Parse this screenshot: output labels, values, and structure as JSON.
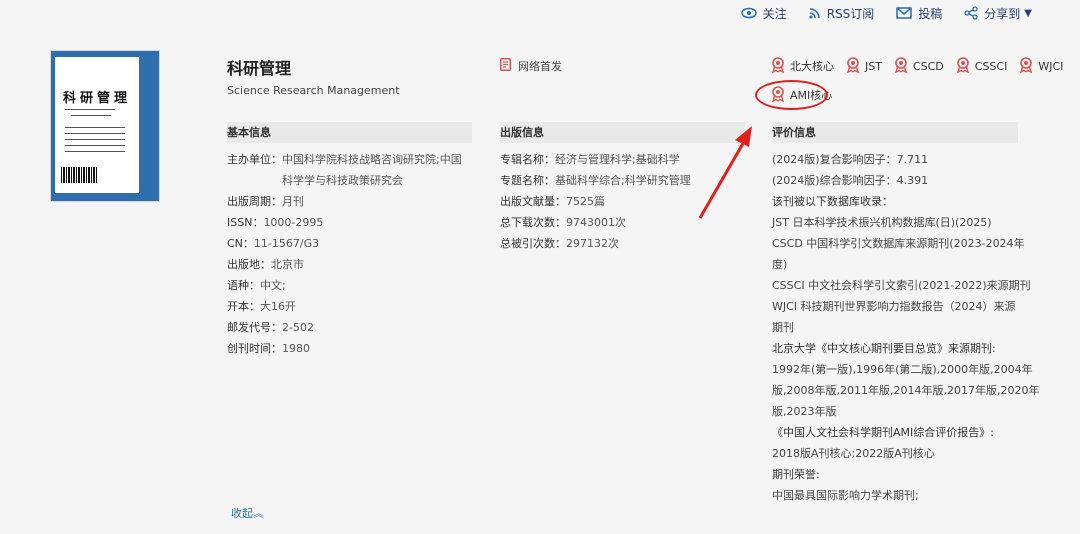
{
  "toolbar": {
    "follow": "关注",
    "rss": "RSS订阅",
    "submit": "投稿",
    "share": "分享到"
  },
  "cover": {
    "title": "科研管理"
  },
  "journal": {
    "title": "科研管理",
    "subtitle": "Science Research Management",
    "net_first": "网络首发"
  },
  "badges": [
    "北大核心",
    "JST",
    "CSCD",
    "CSSCI",
    "WJCI",
    "AMI核心"
  ],
  "basic": {
    "heading": "基本信息",
    "rows": [
      {
        "k": "主办单位：",
        "v": "中国科学院科技战略咨询研究院;中国科学学与科技政策研究会"
      },
      {
        "k": "出版周期：",
        "v": "月刊"
      },
      {
        "k": "ISSN：",
        "v": "1000-2995"
      },
      {
        "k": "CN：",
        "v": "11-1567/G3"
      },
      {
        "k": "出版地：",
        "v": "北京市"
      },
      {
        "k": "语种：",
        "v": "中文;"
      },
      {
        "k": "开本：",
        "v": "大16开"
      },
      {
        "k": "邮发代号：",
        "v": "2-502"
      },
      {
        "k": "创刊时间：",
        "v": "1980"
      }
    ]
  },
  "publish": {
    "heading": "出版信息",
    "rows": [
      {
        "k": "专辑名称：",
        "v": "经济与管理科学;基础科学"
      },
      {
        "k": "专题名称：",
        "v": "基础科学综合;科学研究管理"
      },
      {
        "k": "出版文献量：",
        "v": "7525篇"
      },
      {
        "k": "总下载次数：",
        "v": "9743001次"
      },
      {
        "k": "总被引次数：",
        "v": "297132次"
      }
    ]
  },
  "evaluation": {
    "heading": "评价信息",
    "lines": [
      "(2024版)复合影响因子：7.711",
      "(2024版)综合影响因子：4.391",
      "该刊被以下数据库收录：",
      "JST 日本科学技术振兴机构数据库(日)(2025)",
      "CSCD 中国科学引文数据库来源期刊(2023-2024年",
      "度)",
      "CSSCI 中文社会科学引文索引(2021-2022)来源期刊",
      "WJCI 科技期刊世界影响力指数报告（2024）来源",
      "期刊",
      "北京大学《中文核心期刊要目总览》来源期刊:",
      "1992年(第一版),1996年(第二版),2000年版,2004年",
      "版,2008年版,2011年版,2014年版,2017年版,2020年",
      "版,2023年版",
      "《中国人文社会科学期刊AMI综合评价报告》:",
      "2018版A刊核心;2022版A刊核心",
      "期刊荣誉:",
      "中国最具国际影响力学术期刊;"
    ]
  },
  "collapse": "收起︽",
  "colors": {
    "accent_blue": "#2a6db5",
    "badge_red": "#e05050",
    "annotation_red": "#e0201a"
  }
}
